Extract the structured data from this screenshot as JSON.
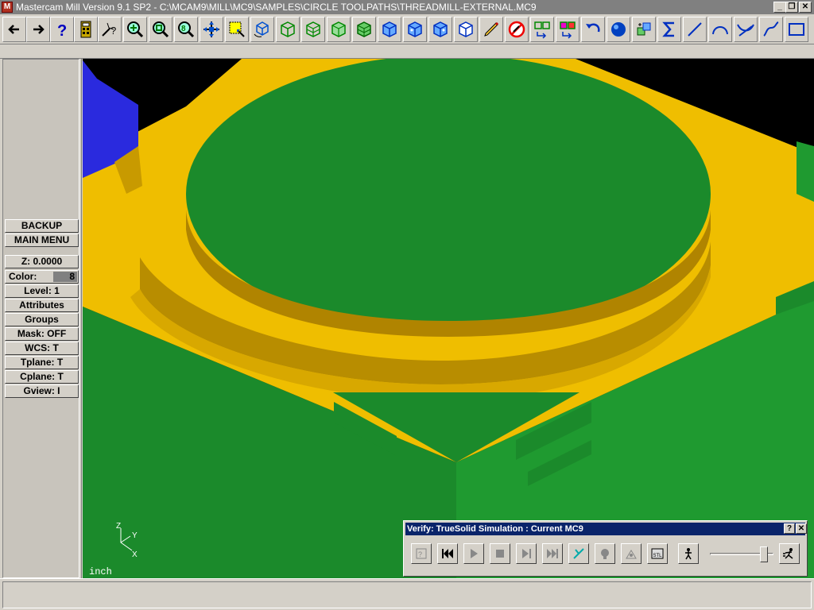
{
  "window": {
    "title": "Mastercam Mill Version 9.1 SP2 - C:\\MCAM9\\MILL\\MC9\\SAMPLES\\CIRCLE TOOLPATHS\\THREADMILL-EXTERNAL.MC9",
    "buttons": [
      "_",
      "❐",
      "✕"
    ]
  },
  "toolbar": {
    "icons": [
      "back-arrow-icon",
      "forward-arrow-icon",
      "help-icon",
      "calculator-icon",
      "pick-query-icon",
      "zoom-icon",
      "unzoom-icon",
      "zoom-fit-icon",
      "pan-icon",
      "screen-select-icon",
      "rotate-icon",
      "wireframe-cube-icon",
      "wireframe-cube-green-icon",
      "wireframe-cube-green2-icon",
      "wireframe-cube-green3-icon",
      "cube-blue-icon",
      "cube-blue2-icon",
      "cube-blue3-icon",
      "cube-blue4-icon",
      "pencil-icon",
      "no-draw-icon",
      "transform-icon",
      "transform-color-icon",
      "undo-icon",
      "sphere-icon",
      "layers-icon",
      "sum-icon",
      "line-icon",
      "arc-icon",
      "trim-icon",
      "spline-icon",
      "rectangle-icon"
    ]
  },
  "left_menu": {
    "backup": "BACKUP",
    "main_menu": "MAIN MENU",
    "z": "Z:  0.0000",
    "color_label": "Color:",
    "color_value": "8",
    "level": "Level:  1",
    "attributes": "Attributes",
    "groups": "Groups",
    "mask": "Mask:  OFF",
    "wcs": "WCS:   T",
    "tplane": "Tplane:  T",
    "cplane": "Cplane:  T",
    "gview": "Gview:   I"
  },
  "viewport": {
    "units": "inch",
    "axis_labels": {
      "z": "Z",
      "y": "Y",
      "x": "X"
    },
    "colors": {
      "stock_top": "#f0c000",
      "stock_side": "#1a8c2a",
      "part": "#1a8c2a",
      "tool": "#2a2adf"
    }
  },
  "verify": {
    "title": "Verify: TrueSolid Simulation : Current MC9",
    "help": "?",
    "close": "✕",
    "buttons": [
      "machine-parameters-icon",
      "rewind-icon",
      "play-icon",
      "stop-icon",
      "step-icon",
      "fast-forward-icon",
      "tool-display-icon",
      "tool-icon",
      "visibility-icon",
      "stl-save-icon",
      "slow-speed-icon",
      "fast-speed-icon"
    ],
    "speed": 0.85
  }
}
